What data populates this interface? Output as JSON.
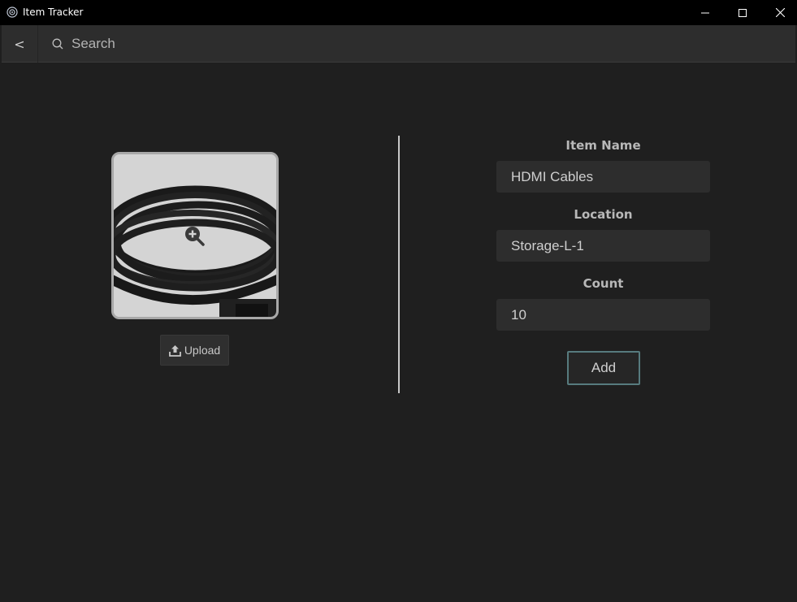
{
  "window": {
    "title": "Item Tracker",
    "app_icon": "gear-icon",
    "controls": [
      "minimize-icon",
      "maximize-icon",
      "close-icon"
    ]
  },
  "search": {
    "back_label": "<",
    "placeholder": "Search",
    "value": ""
  },
  "image": {
    "zoom_icon": "zoom-in-icon",
    "upload_label": "Upload",
    "upload_icon": "upload-icon"
  },
  "form": {
    "item_name_label": "Item Name",
    "item_name_value": "HDMI Cables",
    "location_label": "Location",
    "location_value": "Storage-L-1",
    "count_label": "Count",
    "count_value": "10",
    "add_label": "Add"
  },
  "colors": {
    "background": "#1f1f1f",
    "titlebar": "#000000",
    "input_bg": "#2d2d2d",
    "add_border": "#577b7e"
  }
}
